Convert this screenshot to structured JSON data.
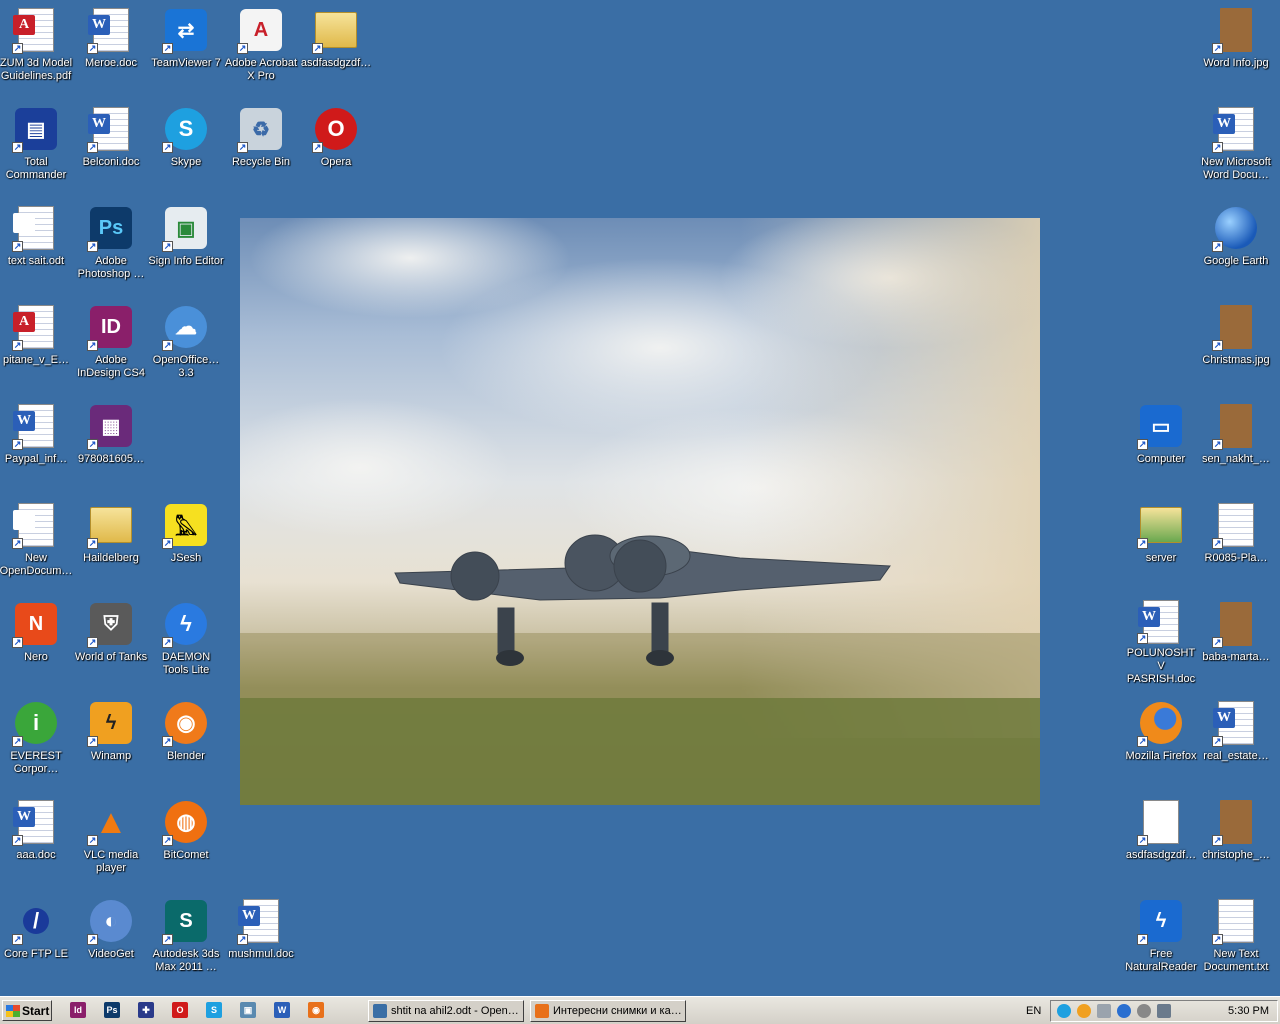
{
  "desktop": {
    "icons_left": [
      {
        "label": "ZUM 3d Model Guidelines.pdf",
        "icon": "pdf-icon"
      },
      {
        "label": "Meroe.doc",
        "icon": "word-doc-icon"
      },
      {
        "label": "TeamViewer 7",
        "icon": "teamviewer-icon"
      },
      {
        "label": "Adobe Acrobat X Pro",
        "icon": "acrobat-icon"
      },
      {
        "label": "asdfasdgzdf…",
        "icon": "folder-icon"
      },
      {
        "label": "Total Commander",
        "icon": "floppy-icon"
      },
      {
        "label": "Belconi.doc",
        "icon": "word-doc-icon"
      },
      {
        "label": "Skype",
        "icon": "skype-icon"
      },
      {
        "label": "Recycle Bin",
        "icon": "recycle-bin-icon"
      },
      {
        "label": "Opera",
        "icon": "opera-icon"
      },
      {
        "label": "text sait.odt",
        "icon": "odt-icon"
      },
      {
        "label": "Adobe Photoshop …",
        "icon": "photoshop-icon"
      },
      {
        "label": "Sign Info Editor",
        "icon": "sign-editor-icon"
      },
      {
        "label": "pitane_v_E…",
        "icon": "pdf-doc-icon"
      },
      {
        "label": "Adobe InDesign CS4",
        "icon": "indesign-icon"
      },
      {
        "label": "OpenOffice… 3.3",
        "icon": "openoffice-icon"
      },
      {
        "label": "Paypal_inf…",
        "icon": "word-doc-icon"
      },
      {
        "label": "978081605…",
        "icon": "winrar-icon"
      },
      {
        "label": "New OpenDocum…",
        "icon": "odt-icon"
      },
      {
        "label": "Haildelberg",
        "icon": "folder-icon"
      },
      {
        "label": "JSesh",
        "icon": "jsesh-icon"
      },
      {
        "label": "Nero",
        "icon": "nero-icon"
      },
      {
        "label": "World of Tanks",
        "icon": "wot-icon"
      },
      {
        "label": "DAEMON Tools Lite",
        "icon": "daemon-tools-icon"
      },
      {
        "label": "EVEREST Corpor…",
        "icon": "everest-icon"
      },
      {
        "label": "Winamp",
        "icon": "winamp-icon"
      },
      {
        "label": "Blender",
        "icon": "blender-icon"
      },
      {
        "label": "aaa.doc",
        "icon": "word-doc-icon"
      },
      {
        "label": "VLC media player",
        "icon": "vlc-icon"
      },
      {
        "label": "BitComet",
        "icon": "bitcomet-icon"
      },
      {
        "label": "Core FTP LE",
        "icon": "coreftp-icon"
      },
      {
        "label": "VideoGet",
        "icon": "videoget-icon"
      },
      {
        "label": "Autodesk 3ds Max 2011 …",
        "icon": "3dsmax-icon"
      },
      {
        "label": "mushmul.doc",
        "icon": "word-doc-icon"
      }
    ],
    "icons_right": [
      {
        "label": "Word Info.jpg",
        "icon": "image-file-icon"
      },
      {
        "label": "New Microsoft Word Docu…",
        "icon": "word-doc-icon"
      },
      {
        "label": "Google Earth",
        "icon": "google-earth-icon"
      },
      {
        "label": "Christmas.jpg",
        "icon": "image-file-icon"
      },
      {
        "label": "Computer",
        "icon": "computer-icon"
      },
      {
        "label": "sen_nakht_…",
        "icon": "image-file-icon"
      },
      {
        "label": "server",
        "icon": "user-folder-icon"
      },
      {
        "label": "R0085-Pla…",
        "icon": "blank-file-icon"
      },
      {
        "label": "POLUNOSHT V PASRISH.doc",
        "icon": "word-doc-icon"
      },
      {
        "label": "baba-marta…",
        "icon": "image-file-icon"
      },
      {
        "label": "Mozilla Firefox",
        "icon": "firefox-icon"
      },
      {
        "label": "real_estate…",
        "icon": "word-doc-icon"
      },
      {
        "label": "asdfasdgzdf…",
        "icon": "firefox-html-icon"
      },
      {
        "label": "christophe_…",
        "icon": "image-file-icon"
      },
      {
        "label": "Free NaturalReader",
        "icon": "naturalreader-icon"
      },
      {
        "label": "New Text Document.txt",
        "icon": "text-file-icon"
      }
    ],
    "wallpaper": "wallpaper-photo-aircraft"
  },
  "taskbar": {
    "start_label": "Start",
    "quick_launch": [
      "indesign-icon",
      "photoshop-icon",
      "uk-flag-icon",
      "opera-icon",
      "skype-icon",
      "sign-editor-icon",
      "word-icon",
      "firefox-icon"
    ],
    "tasks": [
      {
        "label": "shtit na ahil2.odt - Open…",
        "icon": "odt-icon"
      },
      {
        "label": "Интересни снимки и ка…",
        "icon": "firefox-icon"
      }
    ],
    "language": "EN",
    "clock": "5:30 PM"
  },
  "colors": {
    "desktop": "#3a6ea5",
    "taskbar": "#d4d0c8"
  }
}
